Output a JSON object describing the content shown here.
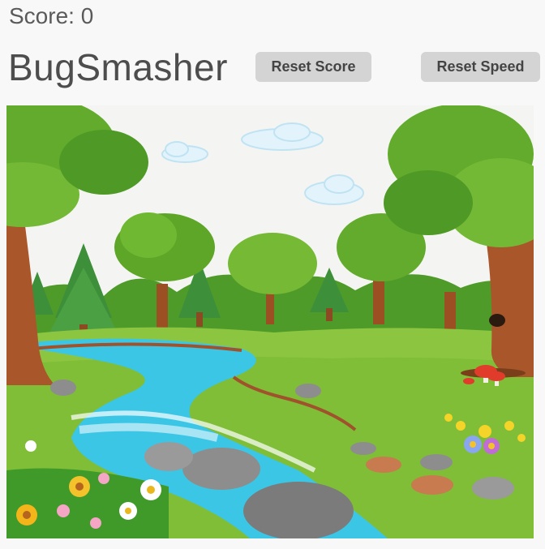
{
  "score": {
    "label": "Score: 0",
    "value": 0
  },
  "title": "BugSmasher",
  "buttons": {
    "reset_score": "Reset Score",
    "reset_speed": "Reset Speed"
  },
  "colors": {
    "page_bg": "#f8f8f8",
    "button_bg": "#d4d4d4",
    "sky": "#f4f4f0",
    "grass": "#8dc63f",
    "water": "#3fc8e8",
    "tree_trunk": "#a0522d",
    "foliage": "#6cb02a"
  }
}
